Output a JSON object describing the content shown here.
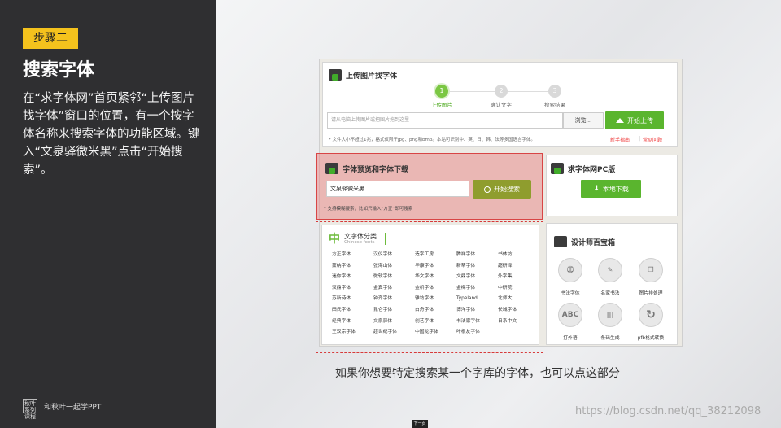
{
  "left": {
    "step_label": "步骤二",
    "title": "搜索字体",
    "description": "在“求字体网”首页紧邻“上传图片找字体”窗口的位置，有一个按字体名称来搜索字体的功能区域。键入“文泉驿微米黑”点击“开始搜索”。",
    "logo_mark": "秋叶 系列课程",
    "logo_text": "和秋叶一起学PPT"
  },
  "upload": {
    "header": "上传图片找字体",
    "steps": [
      {
        "num": "1",
        "label": "上传图片"
      },
      {
        "num": "2",
        "label": "确认文字"
      },
      {
        "num": "3",
        "label": "搜索结果"
      }
    ],
    "input_placeholder": "请从电脑上传图片或把图片拖到这里",
    "browse_label": "浏览...",
    "upload_button": "开始上传",
    "note": "* 文件大小不超过1兆，格式仅限于jpg、png和bmp。本站可识别中、英、日、韩、法等多国语言字体。",
    "guide_link": "新手指南",
    "faq_link": "常见问题"
  },
  "search": {
    "header": "字体预览和字体下载",
    "input_value": "文泉驿微米黑",
    "button": "开始搜索",
    "hint": "* 支持模糊搜索，比如只输入“方正”即可搜索"
  },
  "pc": {
    "header": "求字体网PC版",
    "button": "本地下载"
  },
  "categories": {
    "icon_char": "中",
    "title": "文字体分类",
    "subtitle": "Chinese fonts",
    "items": [
      "方正字体",
      "汉仪字体",
      "造字工房",
      "腾祥字体",
      "书体坊",
      "蒙纳字体",
      "张海山体",
      "华康字体",
      "新蒂字体",
      "超研泽",
      "迷你字体",
      "微软字体",
      "华文字体",
      "文鼎字体",
      "外字集",
      "汉鼎字体",
      "金真字体",
      "金桥字体",
      "金梅字体",
      "中研院",
      "苏新诗体",
      "钟齐字体",
      "雅坊字体",
      "Typeland",
      "北师大",
      "田氏字体",
      "昆仑字体",
      "白舟字体",
      "博洋字体",
      "长城字体",
      "经典字体",
      "文泉驿体",
      "创艺字体",
      "书法家字体",
      "日系中文",
      "王汉宗字体",
      "超世纪字体",
      "中国龙字体",
      "叶根友字体"
    ]
  },
  "tools": {
    "header": "设计师百宝箱",
    "items": [
      {
        "label": "书法字体",
        "icon": "calligraphy-icon",
        "glyph": "㊣"
      },
      {
        "label": "名家书法",
        "icon": "brush-icon",
        "glyph": "✎"
      },
      {
        "label": "图片排处理",
        "icon": "pages-icon",
        "glyph": "❐"
      },
      {
        "label": "打外语",
        "icon": "abc-icon",
        "glyph": "ABC"
      },
      {
        "label": "条码生成",
        "icon": "barcode-icon",
        "glyph": "|||"
      },
      {
        "label": "pfb格式转换",
        "icon": "convert-icon",
        "glyph": "↻"
      }
    ]
  },
  "caption": "如果你想要特定搜索某一个字库的字体，也可以点这部分",
  "watermark": "https://blog.csdn.net/qq_38212098",
  "next_label": "下一页"
}
